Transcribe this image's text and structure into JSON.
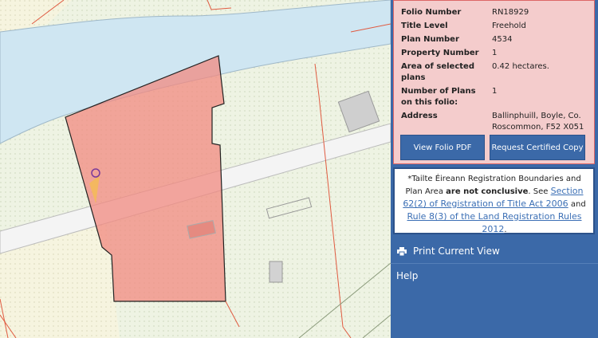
{
  "info": {
    "rows": [
      {
        "key": "Folio Number",
        "value": "RN18929"
      },
      {
        "key": "Title Level",
        "value": "Freehold"
      },
      {
        "key": "Plan Number",
        "value": "4534"
      },
      {
        "key": "Property Number",
        "value": "1"
      },
      {
        "key": "Area of selected plans",
        "value": "0.42 hectares."
      },
      {
        "key": "Number of Plans on this folio:",
        "value": "1"
      },
      {
        "key": "Address",
        "value": "Ballinphuill, Boyle, Co. Roscommon, F52 X051"
      }
    ],
    "buttons": {
      "view_pdf": "View Folio PDF",
      "request_copy": "Request Certified Copy"
    }
  },
  "notice": {
    "text1": "*Tailte Éireann Registration Boundaries and Plan Area",
    "bold": "are not conclusive",
    "text2": ". See",
    "link1": "Section 62(2) of Registration of Title Act 2006",
    "text3": "and",
    "link2": "Rule 8(3) of the Land Registration Rules 2012",
    "text4": "."
  },
  "nav": {
    "print": "Print Current View",
    "help": "Help"
  },
  "colors": {
    "panel": "#3b69a8",
    "info_bg": "#f4cccc",
    "parcel_fill": "#f28a80",
    "river": "#cfe6f2"
  },
  "icons": {
    "print": "printer-icon"
  }
}
